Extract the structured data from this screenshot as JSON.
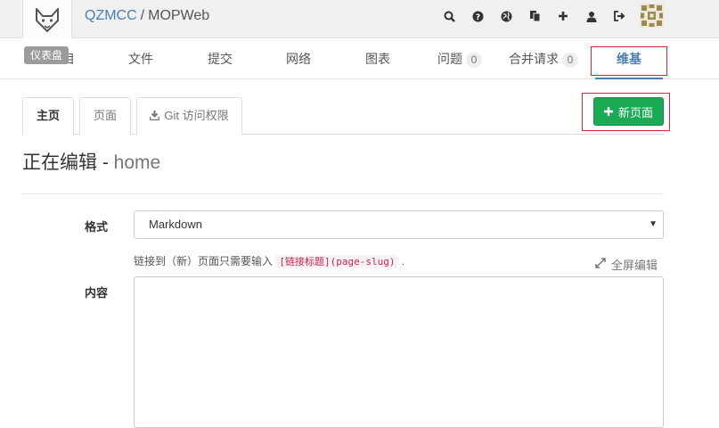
{
  "header": {
    "tooltip": "仪表盘",
    "breadcrumb": {
      "group": "QZMCC",
      "separator": "/",
      "project": "MOPWeb"
    },
    "icons": [
      "search-icon",
      "help-icon",
      "explore-icon",
      "snippets-icon",
      "plus-icon",
      "user-icon",
      "sign-out-icon"
    ]
  },
  "project_nav": {
    "items": [
      {
        "label": "项目"
      },
      {
        "label": "文件"
      },
      {
        "label": "提交"
      },
      {
        "label": "网络"
      },
      {
        "label": "图表"
      },
      {
        "label": "问题",
        "count": "0"
      },
      {
        "label": "合并请求",
        "count": "0"
      },
      {
        "label": "维基",
        "active": true
      }
    ]
  },
  "wiki": {
    "tabs": {
      "home": "主页",
      "pages": "页面",
      "git_access": "Git 访问权限"
    },
    "new_page_button": "新页面",
    "title_prefix": "正在编辑 - ",
    "title_slug": "home"
  },
  "form": {
    "format_label": "格式",
    "format_value": "Markdown",
    "hint_text": "链接到（新）页面只需要输入",
    "hint_code": "[链接标题](page-slug)",
    "hint_end": ".",
    "fullscreen_label": "全屏编辑",
    "content_label": "内容"
  },
  "colors": {
    "accent": "#4a7fb0",
    "button_green": "#1aaa55",
    "highlight_red": "#d9262e"
  }
}
